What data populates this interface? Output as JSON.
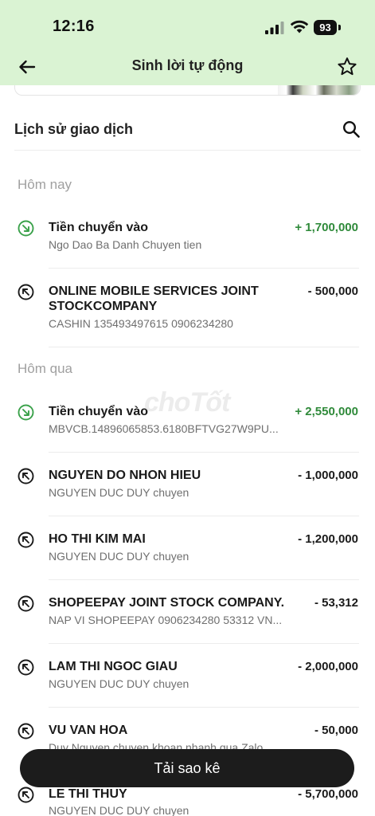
{
  "status_bar": {
    "time": "12:16",
    "battery": "93"
  },
  "header": {
    "title": "Sinh lời tự động"
  },
  "history": {
    "title": "Lịch sử giao dịch"
  },
  "groups": [
    {
      "label": "Hôm nay"
    },
    {
      "label": "Hôm qua"
    }
  ],
  "transactions": [
    {
      "name": "Tiền chuyển vào",
      "sub": "Ngo Dao Ba Danh Chuyen tien",
      "amount": "+ 1,700,000",
      "direction": "in"
    },
    {
      "name": "ONLINE MOBILE SERVICES JOINT STOCKCOMPANY",
      "sub": "CASHIN 135493497615 0906234280",
      "amount": "- 500,000",
      "direction": "out"
    },
    {
      "name": "Tiền chuyển vào",
      "sub": "MBVCB.14896065853.6180BFTVG27W9PU...",
      "amount": "+ 2,550,000",
      "direction": "in"
    },
    {
      "name": "NGUYEN DO NHON HIEU",
      "sub": "NGUYEN DUC DUY chuyen",
      "amount": "- 1,000,000",
      "direction": "out"
    },
    {
      "name": "HO THI KIM MAI",
      "sub": "NGUYEN DUC DUY chuyen",
      "amount": "- 1,200,000",
      "direction": "out"
    },
    {
      "name": "SHOPEEPAY JOINT STOCK COMPANY.",
      "sub": "NAP VI SHOPEEPAY 0906234280 53312 VN...",
      "amount": "- 53,312",
      "direction": "out"
    },
    {
      "name": "LAM THI NGOC GIAU",
      "sub": "NGUYEN DUC DUY chuyen",
      "amount": "- 2,000,000",
      "direction": "out"
    },
    {
      "name": "VU VAN HOA",
      "sub": "Duy Nguyen chuyen khoan nhanh qua Zalo",
      "amount": "- 50,000",
      "direction": "out"
    },
    {
      "name": "LE THI THUY",
      "sub": "NGUYEN DUC DUY chuyen",
      "amount": "- 5,700,000",
      "direction": "out"
    }
  ],
  "watermark": "choTốt",
  "actions": {
    "download_label": "Tải sao kê"
  },
  "colors": {
    "header_bg": "#daf3d3",
    "incoming": "#2f8a3a",
    "button_bg": "#1c1c1c"
  }
}
